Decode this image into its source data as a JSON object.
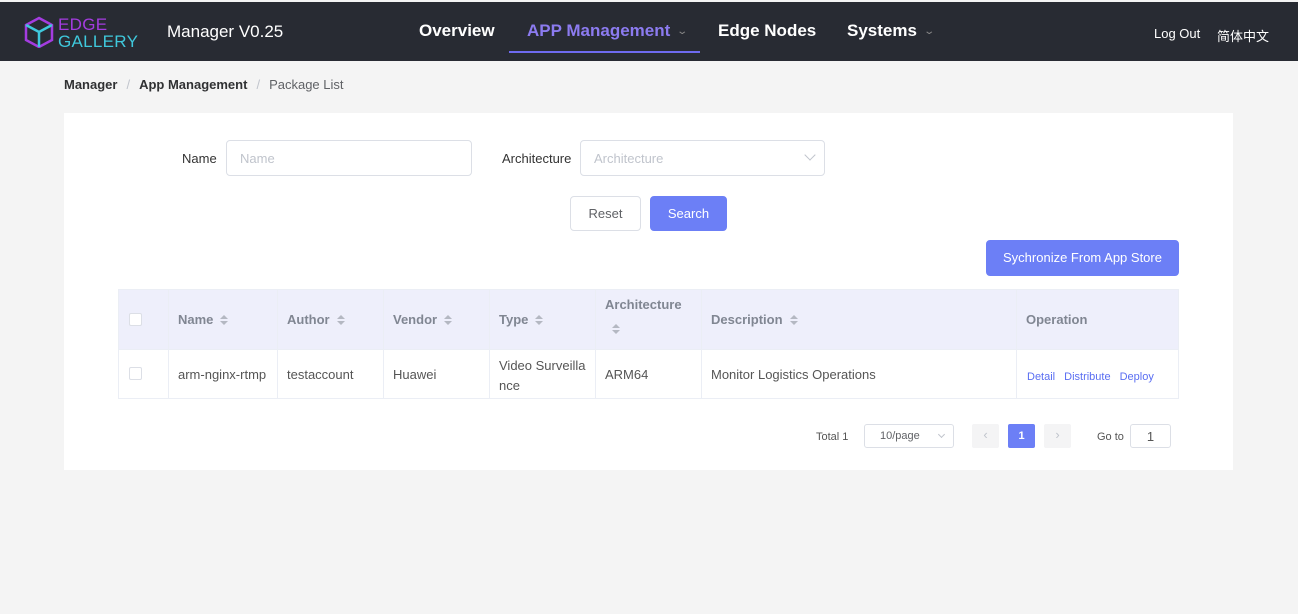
{
  "header": {
    "logo_top": "EDGE",
    "logo_bottom": "GALLERY",
    "app_version": "Manager V0.25",
    "nav": [
      {
        "label": "Overview"
      },
      {
        "label": "APP Management"
      },
      {
        "label": "Edge Nodes"
      },
      {
        "label": "Systems"
      }
    ],
    "logout": "Log Out",
    "language": "简体中文"
  },
  "breadcrumb": [
    "Manager",
    "App Management",
    "Package List"
  ],
  "filters": {
    "name_label": "Name",
    "name_placeholder": "Name",
    "arch_label": "Architecture",
    "arch_placeholder": "Architecture",
    "reset": "Reset",
    "search": "Search"
  },
  "sync_button": "Sychronize From App Store",
  "table": {
    "headers": [
      "Name",
      "Author",
      "Vendor",
      "Type",
      "Architecture",
      "Description",
      "Operation"
    ],
    "rows": [
      {
        "name": "arm-nginx-rtmp",
        "author": "testaccount",
        "vendor": "Huawei",
        "type_line1": "Video Surveilla",
        "type_line2": "nce",
        "architecture": "ARM64",
        "description": "Monitor Logistics Operations",
        "ops": [
          "Detail",
          "Distribute",
          "Deploy"
        ]
      }
    ]
  },
  "pagination": {
    "total": "Total 1",
    "page_size": "10/page",
    "current_page": "1",
    "goto_label": "Go to",
    "goto_value": "1"
  },
  "colors": {
    "header_bg": "#282b33",
    "accent": "#6c7ff6",
    "nav_active": "#8c7bf0"
  }
}
